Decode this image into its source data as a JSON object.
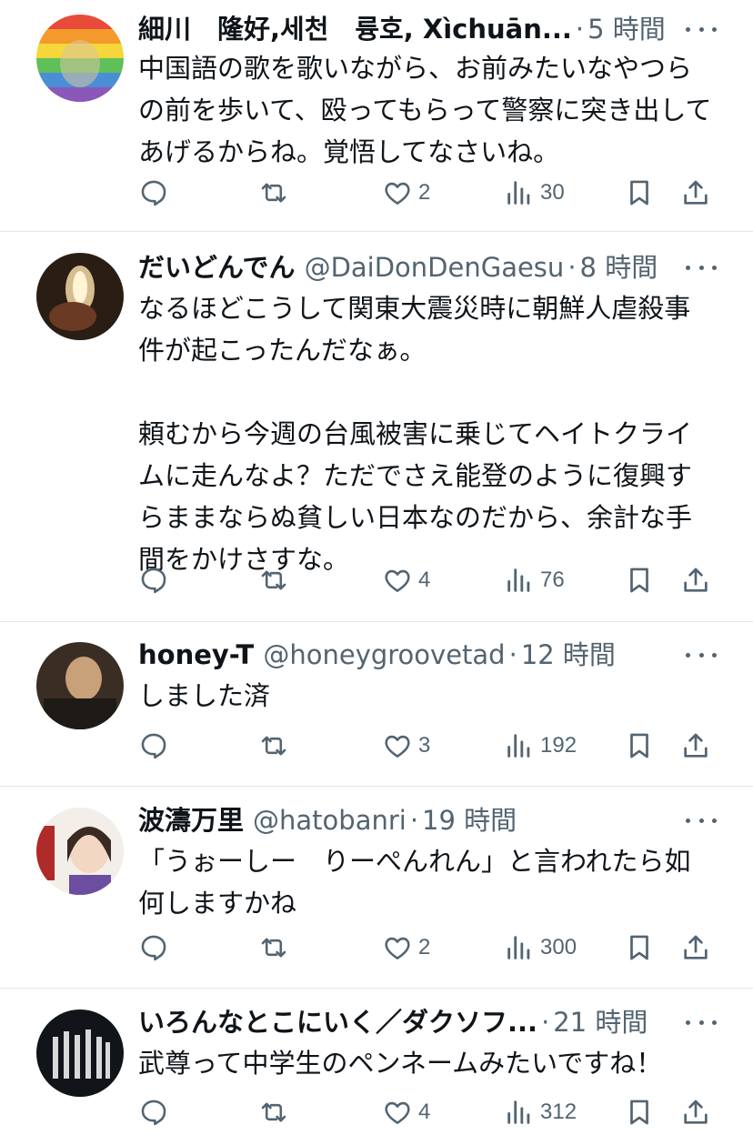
{
  "tweets": [
    {
      "name": "細川　隆好,세천　륭호, Xìchuān...",
      "handle": "",
      "separator": "·",
      "time": "5 時間",
      "body": "中国語の歌を歌いながら、お前みたいなやつらの前を歩いて、殴ってもらって警察に突き出してあげるからね。覚悟してなさいね。",
      "reply_count": "",
      "retweet_count": "",
      "like_count": "2",
      "view_count": "30",
      "avatar": "rainbow-avatar"
    },
    {
      "name": "だいどんでん",
      "handle": "@DaiDonDenGaesu",
      "separator": "·",
      "time": "8 時間",
      "body": "なるほどこうして関東大震災時に朝鮮人虐殺事件が起こったんだなぁ。\n\n頼むから今週の台風被害に乗じてヘイトクライムに走んなよ？ただでさえ能登のように復興すらままならぬ貧しい日本なのだから、余計な手間をかけさすな。",
      "reply_count": "",
      "retweet_count": "",
      "like_count": "4",
      "view_count": "76",
      "avatar": "fire-avatar"
    },
    {
      "name": "honey-T",
      "handle": "@honeygroovetad",
      "separator": "·",
      "time": "12 時間",
      "body": "しました済",
      "reply_count": "",
      "retweet_count": "",
      "like_count": "3",
      "view_count": "192",
      "avatar": "photo-avatar"
    },
    {
      "name": "波濤万里",
      "handle": "@hatobanri",
      "separator": "·",
      "time": "19 時間",
      "body": "「うぉーしー　りーぺんれん」と言われたら如何しますかね",
      "reply_count": "",
      "retweet_count": "",
      "like_count": "2",
      "view_count": "300",
      "avatar": "anime-avatar"
    },
    {
      "name": "いろんなとこにいく／ダクソフ...",
      "handle": "",
      "separator": "·",
      "time": "21 時間",
      "body": "武尊って中学生のペンネームみたいですね！",
      "reply_count": "",
      "retweet_count": "",
      "like_count": "4",
      "view_count": "312",
      "avatar": "figures-avatar"
    }
  ],
  "colors": {
    "text": "#0f1419",
    "secondary": "#536471",
    "divider": "#e4e7ea"
  },
  "icons": [
    "reply-icon",
    "retweet-icon",
    "like-icon",
    "views-icon",
    "bookmark-icon",
    "share-icon",
    "more-icon"
  ]
}
